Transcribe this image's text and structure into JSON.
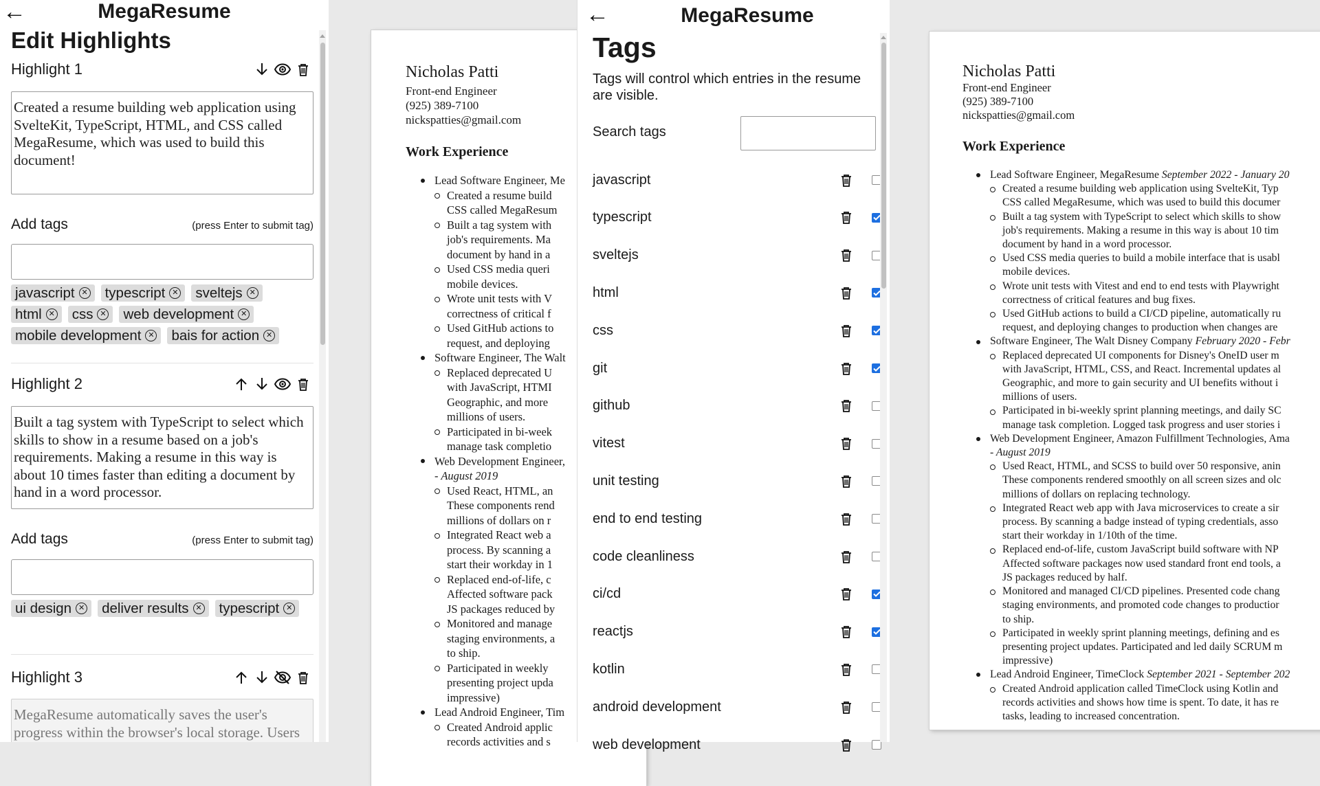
{
  "app": {
    "title": "MegaResume",
    "back_icon": "arrow-left-icon"
  },
  "edit": {
    "page_title": "Edit Highlights",
    "add_tags_label": "Add tags",
    "add_tags_hint": "(press Enter to submit tag)",
    "highlights": [
      {
        "label": "Highlight 1",
        "text": "Created a resume building web application using SvelteKit, TypeScript, HTML, and CSS called MegaResume, which was used to build this document!",
        "tags": [
          "javascript",
          "typescript",
          "sveltejs",
          "html",
          "css",
          "web development",
          "mobile development",
          "bais for action"
        ],
        "visible": true
      },
      {
        "label": "Highlight 2",
        "text": "Built a tag system with TypeScript to select which skills to show in a resume based on a job's requirements. Making a resume in this way is about 10 times faster than editing a document by hand in a word processor.",
        "tags": [
          "ui design",
          "deliver results",
          "typescript"
        ],
        "visible": true
      },
      {
        "label": "Highlight 3",
        "text": "MegaResume automatically saves the user's progress within the browser's local storage. Users",
        "visible": false
      }
    ]
  },
  "tags": {
    "page_title": "Tags",
    "description": "Tags will control which entries in the resume are visible.",
    "search_label": "Search tags",
    "search_value": "",
    "list": [
      {
        "name": "javascript",
        "checked": false
      },
      {
        "name": "typescript",
        "checked": true
      },
      {
        "name": "sveltejs",
        "checked": false
      },
      {
        "name": "html",
        "checked": true
      },
      {
        "name": "css",
        "checked": true
      },
      {
        "name": "git",
        "checked": true
      },
      {
        "name": "github",
        "checked": false
      },
      {
        "name": "vitest",
        "checked": false
      },
      {
        "name": "unit testing",
        "checked": false
      },
      {
        "name": "end to end testing",
        "checked": false
      },
      {
        "name": "code cleanliness",
        "checked": false
      },
      {
        "name": "ci/cd",
        "checked": true
      },
      {
        "name": "reactjs",
        "checked": true
      },
      {
        "name": "kotlin",
        "checked": false
      },
      {
        "name": "android development",
        "checked": false
      },
      {
        "name": "web development",
        "checked": false
      }
    ]
  },
  "resume": {
    "name": "Nicholas Patti",
    "role": "Front-end Engineer",
    "phone": "(925) 389-7100",
    "email": "nickspatties@gmail.com",
    "section": "Work Experience"
  },
  "resume1_lines": [
    {
      "job": "Lead Software Engineer, Me",
      "bullets": [
        [
          "Created a resume build",
          "CSS called MegaResum"
        ],
        [
          "Built a tag system with",
          "job's requirements. Ma",
          "document by hand in a"
        ],
        [
          "Used CSS media queri",
          "mobile devices."
        ],
        [
          "Wrote unit tests with V",
          "correctness of critical f"
        ],
        [
          "Used GitHub actions to",
          "request, and deploying"
        ]
      ]
    },
    {
      "job": "Software Engineer, The Walt",
      "bullets": [
        [
          "Replaced deprecated U",
          "with JavaScript, HTMI",
          "Geographic, and more",
          "millions of users."
        ],
        [
          "Participated in bi-week",
          "manage task completio"
        ]
      ]
    },
    {
      "job": "Web Development Engineer, ",
      "job2": "- August 2019",
      "bullets": [
        [
          "Used React, HTML, an",
          "These components rend",
          "millions of dollars on r"
        ],
        [
          "Integrated React web a",
          "process. By scanning a",
          "start their workday in 1"
        ],
        [
          "Replaced end-of-life, c",
          "Affected software pack",
          "JS packages reduced by"
        ],
        [
          "Monitored and manage",
          "staging environments, a",
          "to ship."
        ],
        [
          "Participated in weekly",
          "presenting project upda",
          "impressive)"
        ]
      ]
    },
    {
      "job": "Lead Android Engineer, Tim",
      "bullets": [
        [
          "Created Android applic",
          "records activities and s"
        ]
      ]
    }
  ],
  "resume2_lines": [
    {
      "job": "Lead Software Engineer, MegaResume ",
      "date": "September 2022 - January 20",
      "bullets": [
        [
          "Created a resume building web application using SvelteKit, Typ",
          "CSS called MegaResume, which was used to build this documer"
        ],
        [
          "Built a tag system with TypeScript to select which skills to show",
          "job's requirements. Making a resume in this way is about 10 tim",
          "document by hand in a word processor."
        ],
        [
          "Used CSS media queries to build a mobile interface that is usabl",
          "mobile devices."
        ],
        [
          "Wrote unit tests with Vitest and end to end tests with Playwright",
          "correctness of critical features and bug fixes."
        ],
        [
          "Used GitHub actions to build a CI/CD pipeline, automatically ru",
          "request, and deploying changes to production when changes are"
        ]
      ]
    },
    {
      "job": "Software Engineer, The Walt Disney Company ",
      "date": "February 2020 - Febr",
      "bullets": [
        [
          "Replaced deprecated UI components for Disney's OneID user m",
          "with JavaScript, HTML, CSS, and React. Incremental updates al",
          "Geographic, and more to gain security and UI benefits without i",
          "millions of users."
        ],
        [
          "Participated in bi-weekly sprint planning meetings, and daily SC",
          "manage task completion. Logged task progress and user stories i"
        ]
      ]
    },
    {
      "job": "Web Development Engineer, Amazon Fulfillment Technologies, Ama",
      "date2": "- August 2019",
      "bullets": [
        [
          "Used React, HTML, and SCSS to build over 50 responsive, anin",
          "These components rendered smoothly on all screen sizes and olc",
          "millions of dollars on replacing technology."
        ],
        [
          "Integrated React web app with Java microservices to create a sir",
          "process. By scanning a badge instead of typing credentials, asso",
          "start their workday in 1/10th of the time."
        ],
        [
          "Replaced end-of-life, custom JavaScript build software with NP",
          "Affected software packages now used standard front end tools, a",
          "JS packages reduced by half."
        ],
        [
          "Monitored and managed CI/CD pipelines. Presented code chang",
          "staging environments, and promoted code changes to productior",
          "to ship."
        ],
        [
          "Participated in weekly sprint planning meetings, defining and es",
          "presenting project updates. Participated and led daily SCRUM m",
          "impressive)"
        ]
      ]
    },
    {
      "job": "Lead Android Engineer, TimeClock ",
      "date": "September 2021 - September 202",
      "bullets": [
        [
          "Created Android application called TimeClock using Kotlin and",
          "records activities and shows how time is spent. To date, it has re",
          "tasks, leading to increased concentration."
        ]
      ]
    }
  ],
  "colors": {
    "accent": "#1d6fe0",
    "chip_bg": "#dcdcdc",
    "page_bg": "#e9e9e9"
  }
}
